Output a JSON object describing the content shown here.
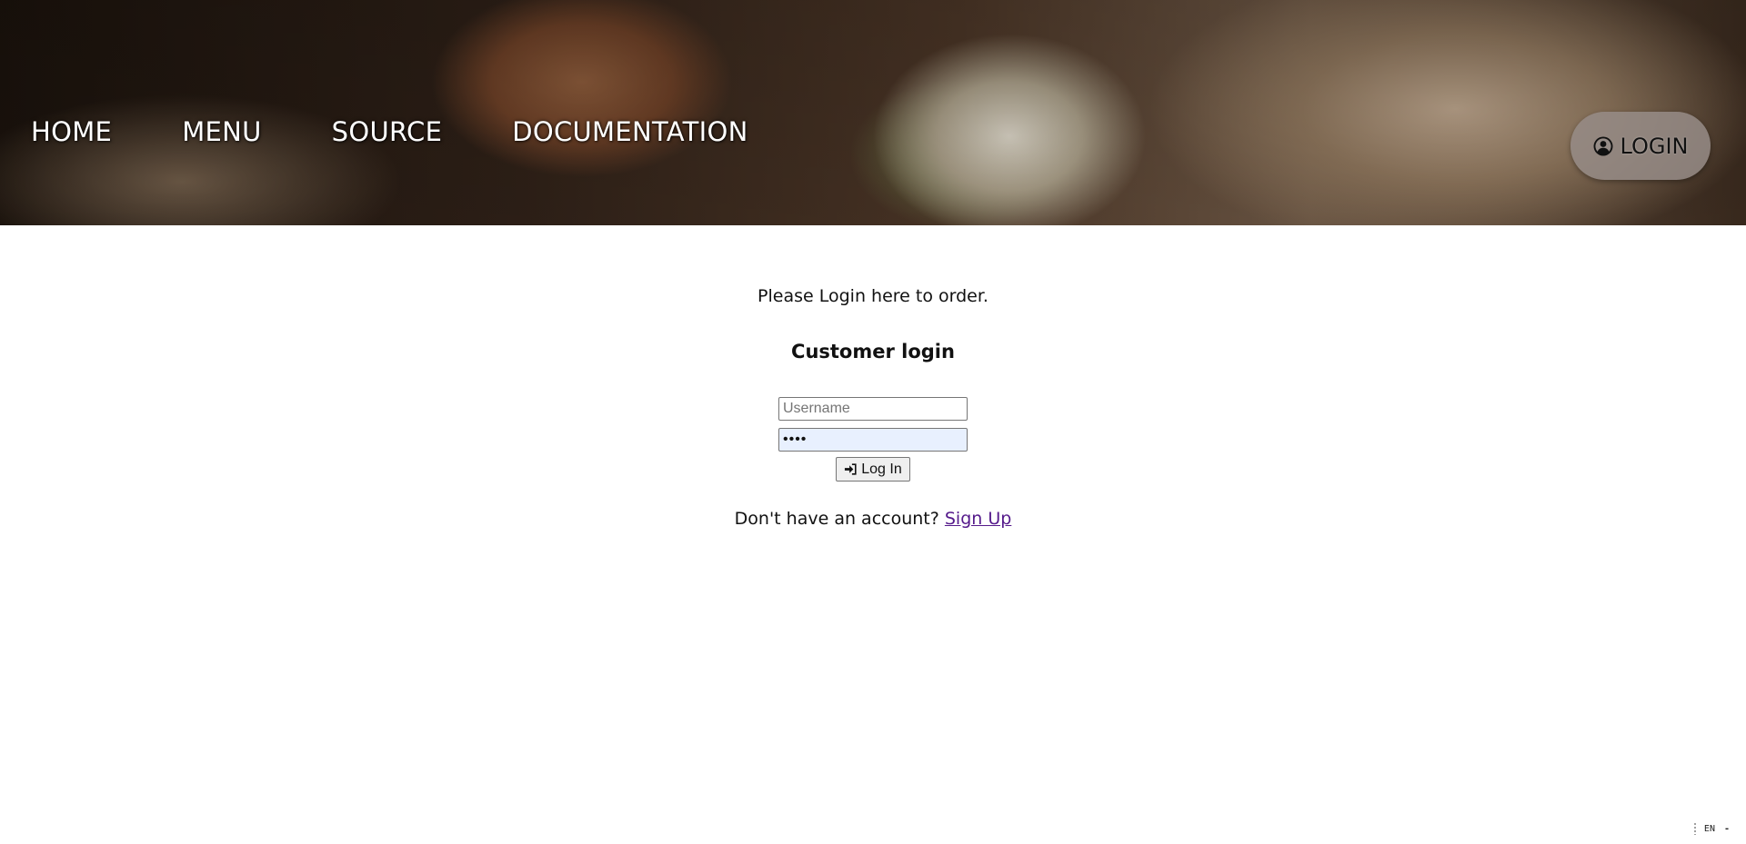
{
  "nav": {
    "items": [
      {
        "label": "HOME"
      },
      {
        "label": "MENU"
      },
      {
        "label": "SOURCE"
      },
      {
        "label": "DOCUMENTATION"
      }
    ],
    "login_label": "LOGIN",
    "login_icon": "user-circle-icon"
  },
  "main": {
    "intro": "Please Login here to order.",
    "heading": "Customer login",
    "username_placeholder": "Username",
    "password_value": "••••",
    "submit_label": "Log In",
    "submit_icon": "sign-in-icon",
    "signup_prompt": "Don't have an account?",
    "signup_link": "Sign Up"
  },
  "corner": {
    "text": "EN",
    "dash": "-"
  },
  "colors": {
    "link": "#551a8b",
    "autofill": "#e8f0fe",
    "login_pill": "#968c87"
  }
}
